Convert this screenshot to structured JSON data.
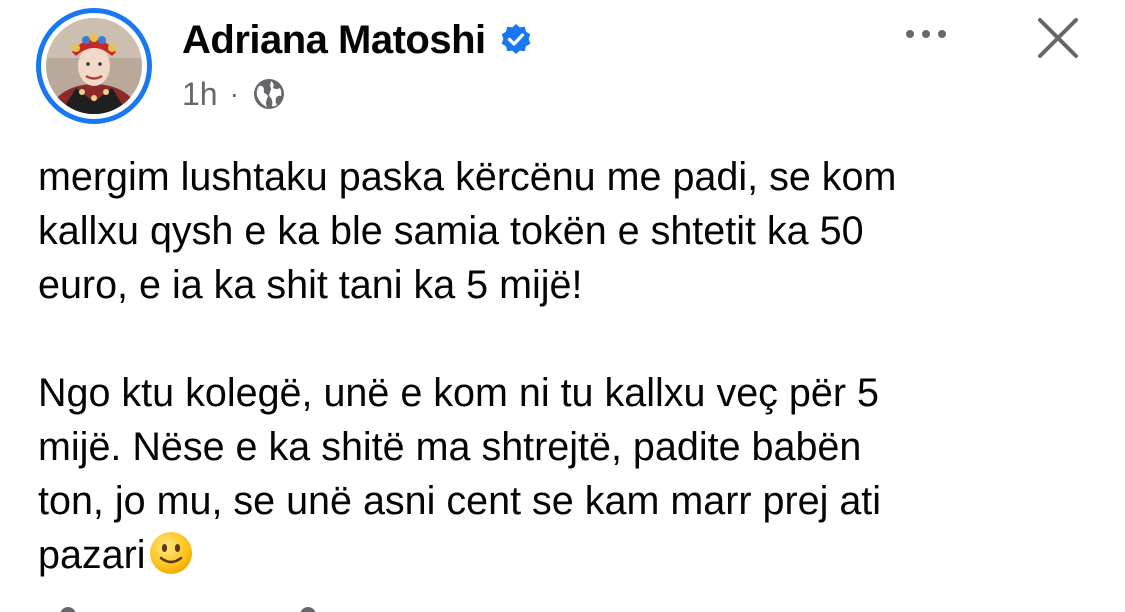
{
  "post": {
    "author": {
      "name": "Adriana Matoshi",
      "verified": true,
      "avatar_icon": "profile-photo"
    },
    "meta": {
      "time": "1h",
      "separator": "·",
      "audience_icon": "globe-icon"
    },
    "actions": {
      "more_icon": "more-horizontal-icon",
      "close_icon": "close-icon"
    },
    "body": {
      "paragraph1": [
        "mergim lushtaku paska kërcënu me padi, se kom",
        "kallxu qysh e ka ble samia tokën e shtetit ka 50",
        "euro, e ia ka shit tani ka 5 mijë!"
      ],
      "paragraph2": [
        "Ngo ktu kolegë, unë e kom ni tu kallxu veç për 5",
        "mijë. Nëse e ka shitë ma shtrejtë,  padite babën",
        "ton, jo mu, se unë asni cent se kam marr prej ati",
        "pazari"
      ],
      "emoji": "slightly-smiling-face"
    }
  },
  "colors": {
    "accent": "#1877f2",
    "text_primary": "#050505",
    "text_secondary": "#65676b"
  }
}
